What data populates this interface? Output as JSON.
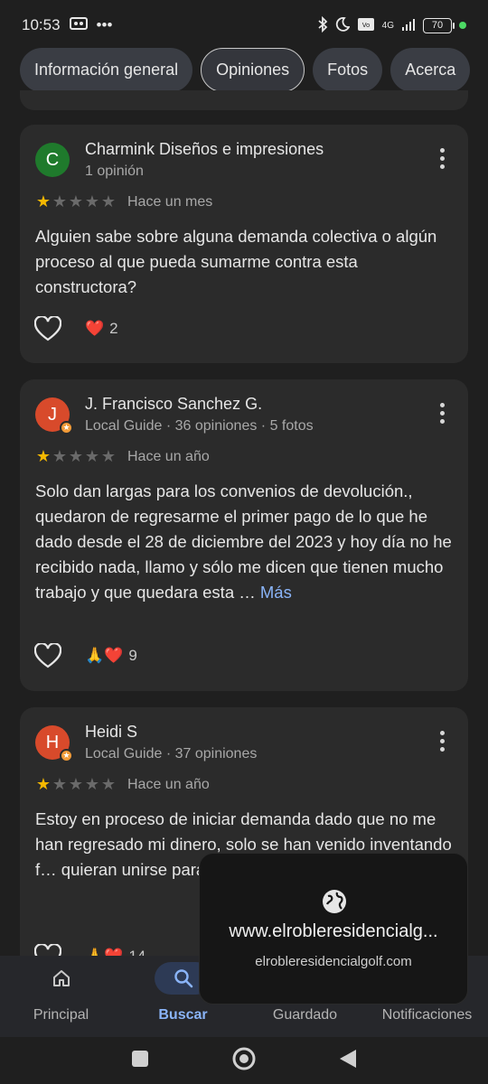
{
  "status_bar": {
    "time": "10:53",
    "battery": "70",
    "network": "4G",
    "volte": "Vo LTE"
  },
  "tabs": [
    {
      "label": "Información general",
      "active": false
    },
    {
      "label": "Opiniones",
      "active": true
    },
    {
      "label": "Fotos",
      "active": false
    },
    {
      "label": "Acerca",
      "active": false
    }
  ],
  "reviews": [
    {
      "avatar_letter": "C",
      "avatar_color": "#1f7a2c",
      "local_guide": false,
      "author": "Charmink Diseños e impresiones",
      "meta": "1 opinión",
      "stars": 1,
      "time": "Hace un mes",
      "text": "Alguien sabe sobre alguna demanda colectiva o algún proceso al que pueda sumarme contra esta constructora?",
      "more_label": "",
      "reaction_emojis": "❤️",
      "reaction_count": "2"
    },
    {
      "avatar_letter": "J",
      "avatar_color": "#d84a2b",
      "local_guide": true,
      "author": "J. Francisco Sanchez G.",
      "meta": "Local Guide · 36 opiniones · 5 fotos",
      "stars": 1,
      "time": "Hace un año",
      "text": "Solo dan largas para los convenios de devolución., quedaron de regresarme el primer pago de lo que he dado desde el 28 de diciembre del 2023 y hoy día no he recibido nada, llamo y sólo me dicen que tienen mucho trabajo y que quedara esta …",
      "more_label": "Más",
      "reaction_emojis": "🙏❤️",
      "reaction_count": "9"
    },
    {
      "avatar_letter": "H",
      "avatar_color": "#d84a2b",
      "local_guide": true,
      "author": "Heidi S",
      "meta": "Local Guide · 37 opiniones",
      "stars": 1,
      "time": "Hace un año",
      "text": "Estoy en proceso de iniciar demanda dado que no me han regresado mi dinero, solo se han venido inventando f… quieran unirse para… desarrolladora por …",
      "more_label": "",
      "reaction_emojis": "🙏❤️",
      "reaction_count": "14"
    }
  ],
  "bottom_nav": [
    {
      "label": "Principal",
      "icon": "home-icon",
      "active": false
    },
    {
      "label": "Buscar",
      "icon": "search-icon",
      "active": true
    },
    {
      "label": "Guardado",
      "icon": "bookmark-icon",
      "active": false
    },
    {
      "label": "Notificaciones",
      "icon": "bell-icon",
      "active": false
    }
  ],
  "tooltip": {
    "icon": "globe-icon",
    "title": "www.elrobleresidencialg...",
    "subtitle": "elrobleresidencialgolf.com"
  },
  "colors": {
    "background": "#1f1f1f",
    "card": "#2b2b2b",
    "accent": "#8ab4f8",
    "star": "#f5b800"
  }
}
